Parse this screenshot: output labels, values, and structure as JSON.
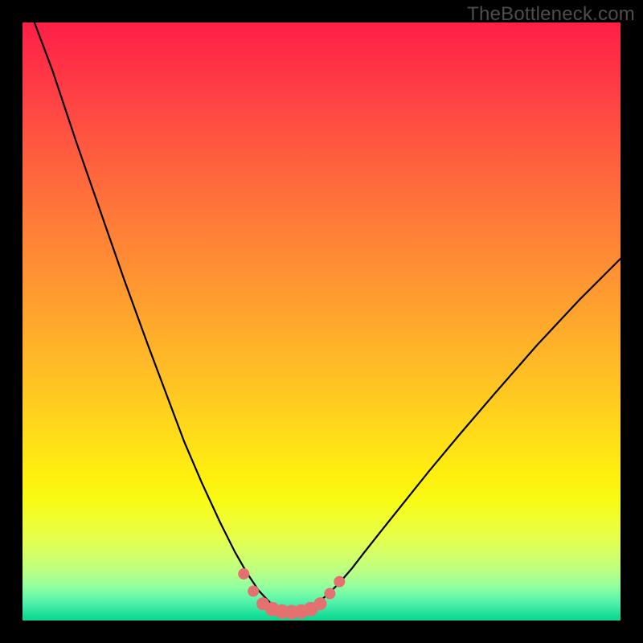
{
  "watermark": "TheBottleneck.com",
  "colors": {
    "frame_bg": "#000000",
    "curve_stroke": "#000000",
    "marker_fill": "#e4716f",
    "gradient_top": "#ff1f47",
    "gradient_bottom": "#0bd991"
  },
  "chart_data": {
    "type": "line",
    "title": "",
    "xlabel": "",
    "ylabel": "",
    "xlim": [
      0,
      100
    ],
    "ylim": [
      0,
      100
    ],
    "grid": false,
    "legend": false,
    "note": "Axes and tick labels are not rendered; values are read off pixel positions relative to the 744×744 plotting area (x% = left→right, y% = bottom→top).",
    "series": [
      {
        "name": "bottleneck-curve",
        "x": [
          2,
          5,
          9,
          13,
          17,
          21,
          24,
          27,
          30,
          33,
          35.5,
          37.5,
          39.5,
          41,
          42,
          43,
          44,
          45,
          46,
          47,
          49,
          51,
          53,
          55,
          57,
          60,
          64,
          68,
          73,
          79,
          86,
          93,
          100
        ],
        "y": [
          100,
          92,
          80,
          68.5,
          57,
          46,
          38,
          30,
          23,
          16.5,
          11.5,
          8,
          5,
          3.4,
          2.4,
          1.8,
          1.5,
          1.4,
          1.5,
          1.8,
          2.7,
          4.3,
          6.3,
          8.6,
          11.2,
          15,
          20,
          25,
          31,
          38,
          46,
          53.5,
          60.5
        ]
      },
      {
        "name": "bottom-markers",
        "kind": "scatter",
        "x": [
          37.0,
          38.6,
          40.2,
          41.8,
          43.4,
          45.0,
          46.6,
          48.2,
          49.8,
          51.4,
          53.0
        ],
        "y": [
          7.8,
          4.9,
          2.8,
          1.9,
          1.5,
          1.4,
          1.5,
          1.9,
          2.8,
          4.5,
          6.5
        ],
        "r": [
          7,
          7,
          8,
          9,
          9,
          9,
          9,
          9,
          8,
          7,
          7
        ]
      }
    ]
  }
}
